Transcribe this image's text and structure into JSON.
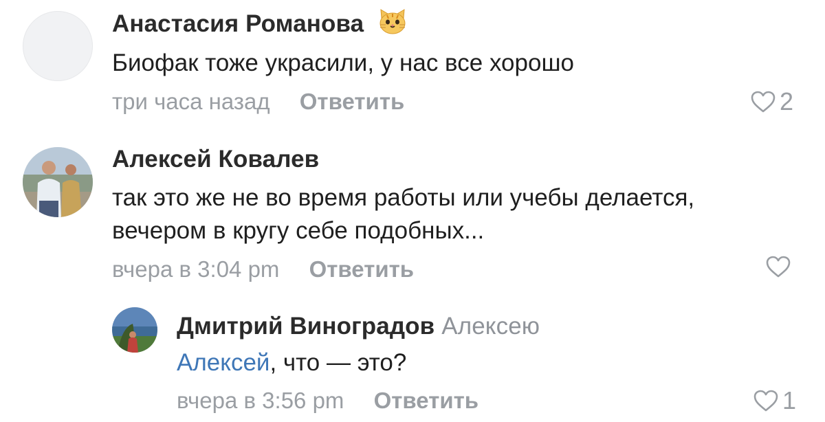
{
  "comments": [
    {
      "author": "Анастасия Романова",
      "author_emoji": "cat-face-emoji",
      "text": "Биофак тоже украсили, у нас все хорошо",
      "time": "три часа назад",
      "reply_label": "Ответить",
      "likes": "2"
    },
    {
      "author": "Алексей Ковалев",
      "text_line1": "так это же не во время работы или учебы делается,",
      "text_line2": "вечером в кругу себе подобных...",
      "time": "вчера в 3:04 pm",
      "reply_label": "Ответить",
      "likes": ""
    },
    {
      "author": "Дмитрий Виноградов",
      "reply_to": "Алексею",
      "mention": "Алексей",
      "text": ", что — это?",
      "time": "вчера в 3:56 pm",
      "reply_label": "Ответить",
      "likes": "1"
    }
  ],
  "colors": {
    "mention": "#3f77b7",
    "meta": "#9a9ea3",
    "author": "#2b2b2b"
  },
  "icons": {
    "like": "heart-outline-icon"
  }
}
